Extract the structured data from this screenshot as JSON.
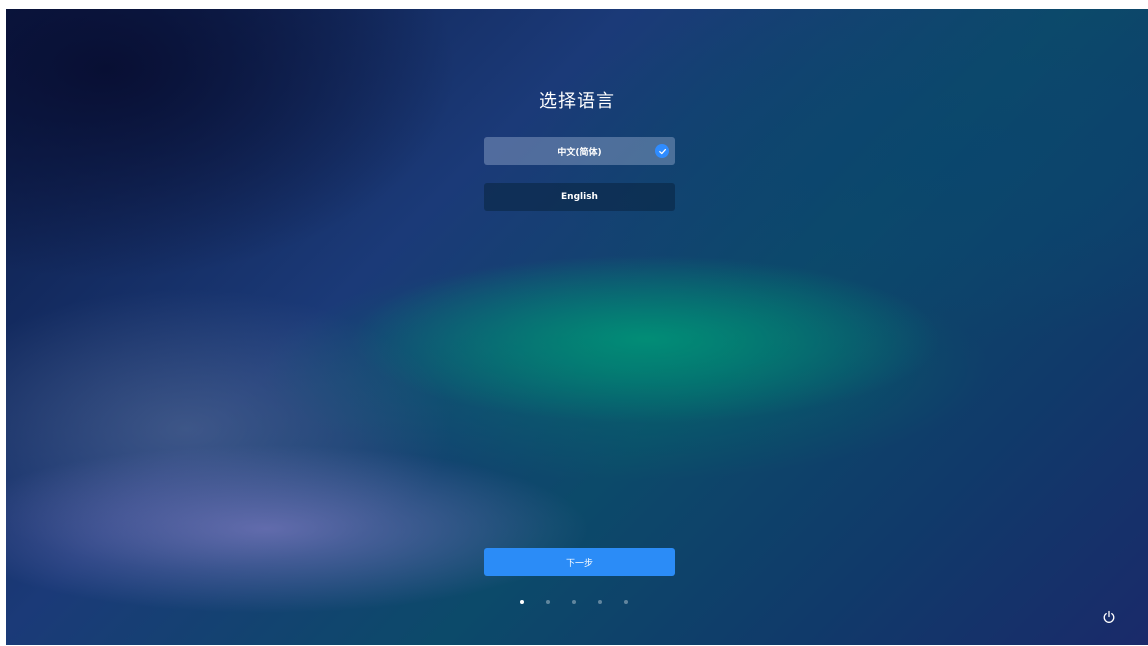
{
  "setup": {
    "title": "选择语言",
    "languages": [
      {
        "label": "中文(简体)",
        "selected": true
      },
      {
        "label": "English",
        "selected": false
      }
    ],
    "next_label": "下一步",
    "steps_total": 5,
    "current_step": 1
  },
  "icons": {
    "check": "check-icon",
    "power": "power-icon"
  },
  "colors": {
    "accent": "#2b8cf7"
  }
}
